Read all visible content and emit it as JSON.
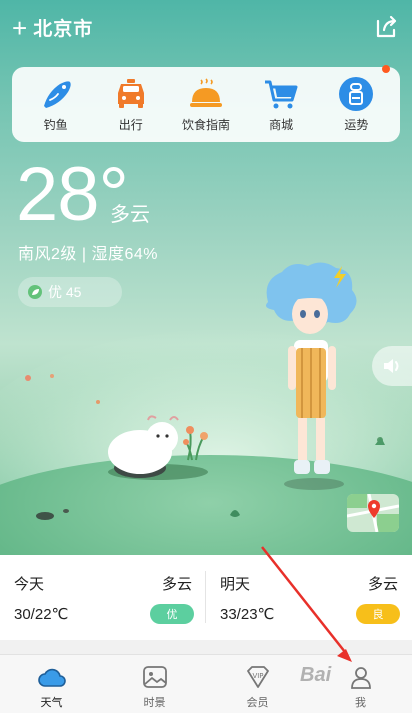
{
  "header": {
    "plus": "+",
    "city": "北京市"
  },
  "quick_links": [
    {
      "label": "钓鱼",
      "icon": "fish-icon"
    },
    {
      "label": "出行",
      "icon": "taxi-icon"
    },
    {
      "label": "饮食指南",
      "icon": "food-cloche-icon"
    },
    {
      "label": "商城",
      "icon": "shopping-cart-icon"
    },
    {
      "label": "运势",
      "icon": "fortune-icon"
    }
  ],
  "current": {
    "temperature": "28°",
    "condition": "多云",
    "wind_humidity": "南风2级 | 湿度64%",
    "aqi": "优 45"
  },
  "forecast": [
    {
      "day": "今天",
      "condition": "多云",
      "range": "30/22℃",
      "badge": "优",
      "badge_color": "#5ccf9f"
    },
    {
      "day": "明天",
      "condition": "多云",
      "range": "33/23℃",
      "badge": "良",
      "badge_color": "#f7bf1a"
    }
  ],
  "tabs": [
    {
      "label": "天气",
      "active": true
    },
    {
      "label": "时景",
      "active": false
    },
    {
      "label": "会员",
      "active": false
    },
    {
      "label": "我",
      "active": false
    }
  ],
  "watermark": "Bai",
  "colors": {
    "primary": "#3a9be8",
    "annotation_arrow": "#e8302a"
  }
}
